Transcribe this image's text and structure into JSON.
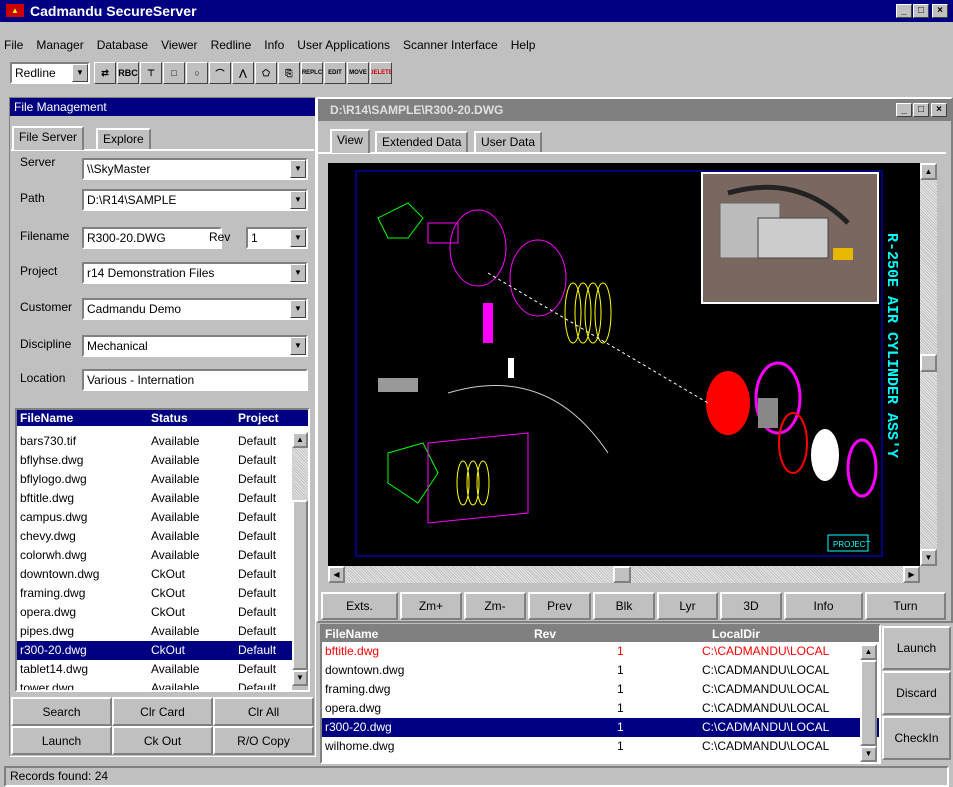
{
  "window": {
    "title": "Cadmandu SecureServer",
    "min": "_",
    "max": "□",
    "close": "×"
  },
  "menu": [
    "File",
    "Manager",
    "Database",
    "Viewer",
    "Redline",
    "Info",
    "User Applications",
    "Scanner Interface",
    "Help"
  ],
  "toolbar": {
    "mode": "Redline",
    "buttons": [
      "⇄",
      "RBC",
      "⊤",
      "□",
      "○",
      "⌒",
      "⋀",
      "⬠",
      "⎘",
      "REPLC",
      "EDIT",
      "MOVE",
      "DELETE"
    ]
  },
  "file_mgmt": {
    "title": "File Management",
    "tabs": [
      "File Server",
      "Explore"
    ],
    "fields": [
      {
        "label": "Server",
        "value": "\\\\SkyMaster",
        "dropdown": true
      },
      {
        "label": "Path",
        "value": "D:\\R14\\SAMPLE",
        "dropdown": true
      },
      {
        "label": "Filename",
        "value": "R300-20.DWG",
        "dropdown": false
      },
      {
        "label": "Project",
        "value": "r14 Demonstration Files",
        "dropdown": true
      },
      {
        "label": "Customer",
        "value": "Cadmandu Demo",
        "dropdown": true
      },
      {
        "label": "Discipline",
        "value": "Mechanical",
        "dropdown": true
      },
      {
        "label": "Location",
        "value": "Various - Internation",
        "dropdown": false
      }
    ],
    "rev_label": "Rev",
    "rev_value": "1"
  },
  "file_list": {
    "headers": [
      "FileName",
      "Status",
      "Project"
    ],
    "rows": [
      [
        "bars730.tif",
        "Available",
        "Default"
      ],
      [
        "bflyhse.dwg",
        "Available",
        "Default"
      ],
      [
        "bflylogo.dwg",
        "Available",
        "Default"
      ],
      [
        "bftitle.dwg",
        "Available",
        "Default"
      ],
      [
        "campus.dwg",
        "Available",
        "Default"
      ],
      [
        "chevy.dwg",
        "Available",
        "Default"
      ],
      [
        "colorwh.dwg",
        "Available",
        "Default"
      ],
      [
        "downtown.dwg",
        "CkOut",
        "Default"
      ],
      [
        "framing.dwg",
        "CkOut",
        "Default"
      ],
      [
        "opera.dwg",
        "CkOut",
        "Default"
      ],
      [
        "pipes.dwg",
        "Available",
        "Default"
      ],
      [
        "r300-20.dwg",
        "CkOut",
        "Default"
      ],
      [
        "tablet14.dwg",
        "Available",
        "Default"
      ],
      [
        "tower.dwg",
        "Available",
        "Default"
      ]
    ],
    "selected": 11
  },
  "left_buttons": [
    [
      "Search",
      "Clr Card",
      "Clr All"
    ],
    [
      "Launch",
      "Ck Out",
      "R/O Copy"
    ]
  ],
  "viewer": {
    "title": "D:\\R14\\SAMPLE\\R300-20.DWG",
    "tabs": [
      "View",
      "Extended Data",
      "User Data"
    ],
    "drawing_text": "R-250E AIR CYLINDER ASS'Y",
    "stamp": "PROJECT",
    "buttons": [
      "Exts.",
      "Zm+",
      "Zm-",
      "Prev",
      "Blk",
      "Lyr",
      "3D",
      "Info",
      "Turn"
    ]
  },
  "checkout": {
    "headers": [
      "FileName",
      "Rev",
      "LocalDir"
    ],
    "rows": [
      {
        "name": "bftitle.dwg",
        "rev": "1",
        "dir": "C:\\CADMANDU\\LOCAL",
        "color": "#ff0000"
      },
      {
        "name": "downtown.dwg",
        "rev": "1",
        "dir": "C:\\CADMANDU\\LOCAL",
        "color": "#000000"
      },
      {
        "name": "framing.dwg",
        "rev": "1",
        "dir": "C:\\CADMANDU\\LOCAL",
        "color": "#000000"
      },
      {
        "name": "opera.dwg",
        "rev": "1",
        "dir": "C:\\CADMANDU\\LOCAL",
        "color": "#000000"
      },
      {
        "name": "r300-20.dwg",
        "rev": "1",
        "dir": "C:\\CADMANDU\\LOCAL",
        "color": "#ffffff"
      },
      {
        "name": "wilhome.dwg",
        "rev": "1",
        "dir": "C:\\CADMANDU\\LOCAL",
        "color": "#000000"
      }
    ],
    "selected": 4,
    "buttons": [
      "Launch",
      "Discard",
      "CheckIn"
    ]
  },
  "status": {
    "text": "Records found: 24"
  }
}
